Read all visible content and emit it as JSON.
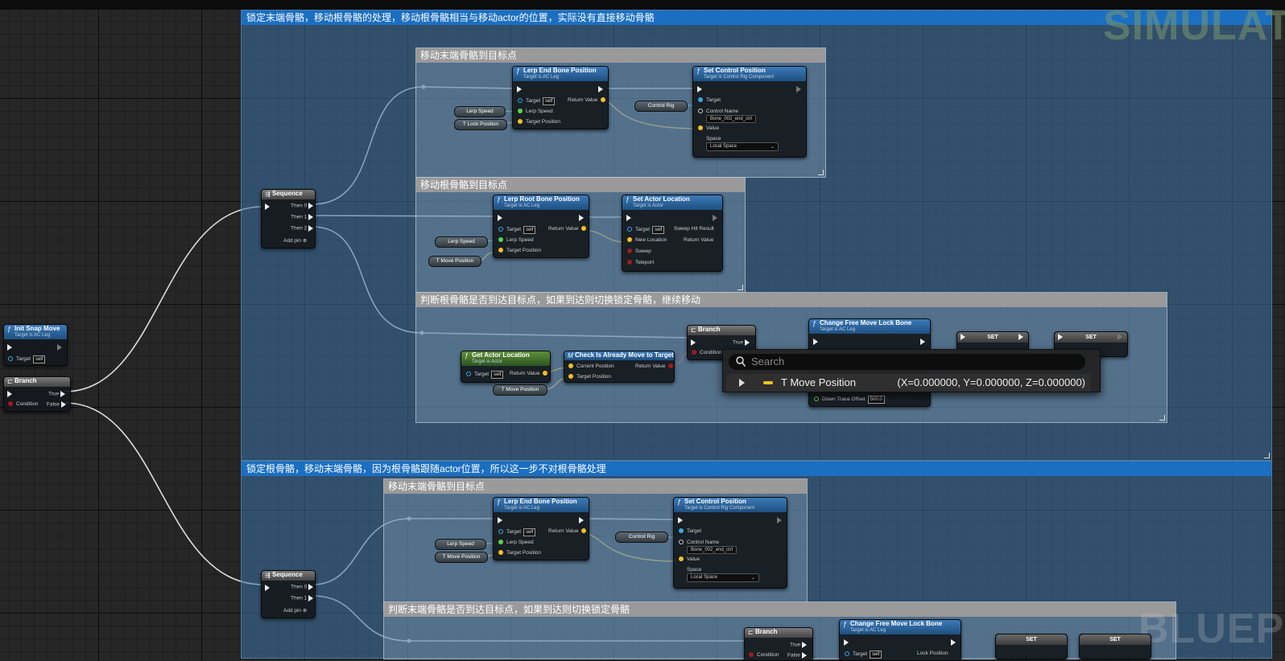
{
  "watermarks": {
    "top_right": "SIMULAT",
    "bottom_right": "BLUEPR"
  },
  "colors": {
    "exec": "#ffffff",
    "vector": "#f4c024",
    "float": "#5cd04b",
    "object": "#3aa7e2",
    "bool": "#9e1c1c",
    "comment_header": "#1b6fc2"
  },
  "comments": {
    "top_group": "锁定末端骨骼，移动根骨骼的处理，移动根骨骼相当与移动actor的位置，实际没有直接移动骨骼",
    "move_end_1": "移动末端骨骼到目标点",
    "move_root": "移动根骨骼到目标点",
    "check_root": "判断根骨骼是否到达目标点，如果到达则切换锁定骨骼，继续移动",
    "bottom_group": "锁定根骨骼，移动末端骨骼，因为根骨骼跟随actor位置，所以这一步不对根骨骼处理",
    "move_end_2": "移动末端骨骼到目标点",
    "check_end": "判断末端骨骼是否到达目标点，如果到达则切换锁定骨骼"
  },
  "pins": {
    "target": "Target",
    "self": "self",
    "return_value": "Return Value",
    "lerp_speed": "Lerp Speed",
    "target_position": "Target Position",
    "control_name": "Control Name",
    "value": "Value",
    "space": "Space",
    "then0": "Then 0",
    "then1": "Then 1",
    "then2": "Then 2",
    "add_pin": "Add pin",
    "true": "True",
    "false": "False",
    "condition": "Condition",
    "sweep_hit_result": "Sweep Hit Result",
    "new_location": "New Location",
    "sweep": "Sweep",
    "teleport": "Teleport",
    "current_position": "Current Position",
    "down_trace_offset": "Down Trace Offset",
    "lock_position": "Lock Position"
  },
  "nodes": {
    "init_snap_move": {
      "title": "Init Snap Move",
      "sub": "Target is AC Leg"
    },
    "branch": {
      "title": "Branch"
    },
    "sequence": {
      "title": "Sequence"
    },
    "lerp_end_bone": {
      "title": "Lerp End Bone Position",
      "sub": "Target is AC Leg"
    },
    "lerp_root_bone": {
      "title": "Lerp Root Bone Position",
      "sub": "Target is AC Leg"
    },
    "set_control_position": {
      "title": "Set Control Position",
      "sub": "Target is Control Rig Component",
      "control_name_value": "Bone_002_end_ctrl",
      "space_value": "Local Space"
    },
    "set_actor_location": {
      "title": "Set Actor Location",
      "sub": "Target is Actor"
    },
    "get_actor_location": {
      "title": "Get Actor Location",
      "sub": "Target is Actor"
    },
    "check_already_move": {
      "title": "Check Is Already Move to Target"
    },
    "change_free_move": {
      "title": "Change Free Move Lock Bone",
      "sub": "Target is AC Leg",
      "down_trace_value": "500.0"
    },
    "set": {
      "title": "SET"
    }
  },
  "variables": {
    "lerp_speed": "Lerp Speed",
    "t_lock_position": "T Lock Position",
    "t_move_position": "T Move Position",
    "control_rig": "Control Rig"
  },
  "search_popup": {
    "placeholder": "Search",
    "result": {
      "name": "T Move Position",
      "value": "(X=0.000000, Y=0.000000, Z=0.000000)"
    }
  }
}
